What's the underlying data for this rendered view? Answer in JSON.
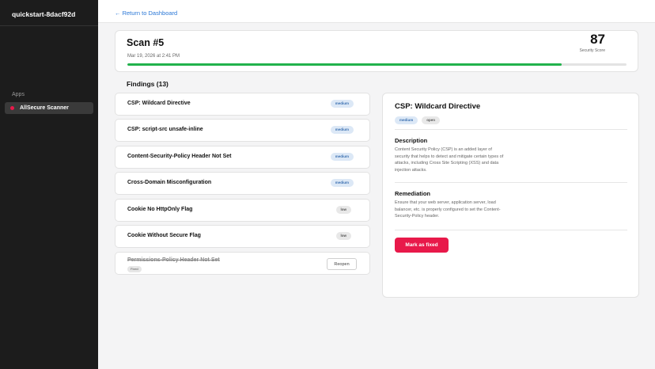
{
  "sidebar": {
    "org_name": "quickstart-8dacf92d",
    "section_label": "Apps",
    "apps": [
      {
        "label": "AllSecure Scanner",
        "active": true
      }
    ]
  },
  "topbar": {
    "back_link": "← Return to Dashboard"
  },
  "scan": {
    "title": "Scan #5",
    "date": "Mar 19, 2026 at 2:41 PM",
    "score": "87",
    "score_label": "Security Score",
    "progress_percent": 87
  },
  "findings": {
    "header": "Findings (13)",
    "items": [
      {
        "title": "CSP: Wildcard Directive",
        "severity": "medium"
      },
      {
        "title": "CSP: script-src unsafe-inline",
        "severity": "medium"
      },
      {
        "title": "Content-Security-Policy Header Not Set",
        "severity": "medium"
      },
      {
        "title": "Cross-Domain Misconfiguration",
        "severity": "medium"
      },
      {
        "title": "Cookie No HttpOnly Flag",
        "severity": "low"
      },
      {
        "title": "Cookie Without Secure Flag",
        "severity": "low"
      },
      {
        "title": "Permissions-Policy Header Not Set",
        "status": "Fixed",
        "action": "Reopen"
      }
    ]
  },
  "detail": {
    "title": "CSP: Wildcard Directive",
    "severity": "medium",
    "status": "open",
    "description_heading": "Description",
    "description": "Content Security Policy (CSP) is an added layer of security that helps to detect and mitigate certain types of attacks, including Cross Site Scripting (XSS) and data injection attacks.",
    "remediation_heading": "Remediation",
    "remediation": "Ensure that your web server, application server, load balancer, etc. is properly configured to set the Content-Security-Policy header.",
    "fix_button": "Mark as fixed"
  },
  "colors": {
    "accent": "#e8194a",
    "link": "#2a77d6",
    "progress": "#22b24c",
    "sidebar": "#1c1c1c"
  }
}
